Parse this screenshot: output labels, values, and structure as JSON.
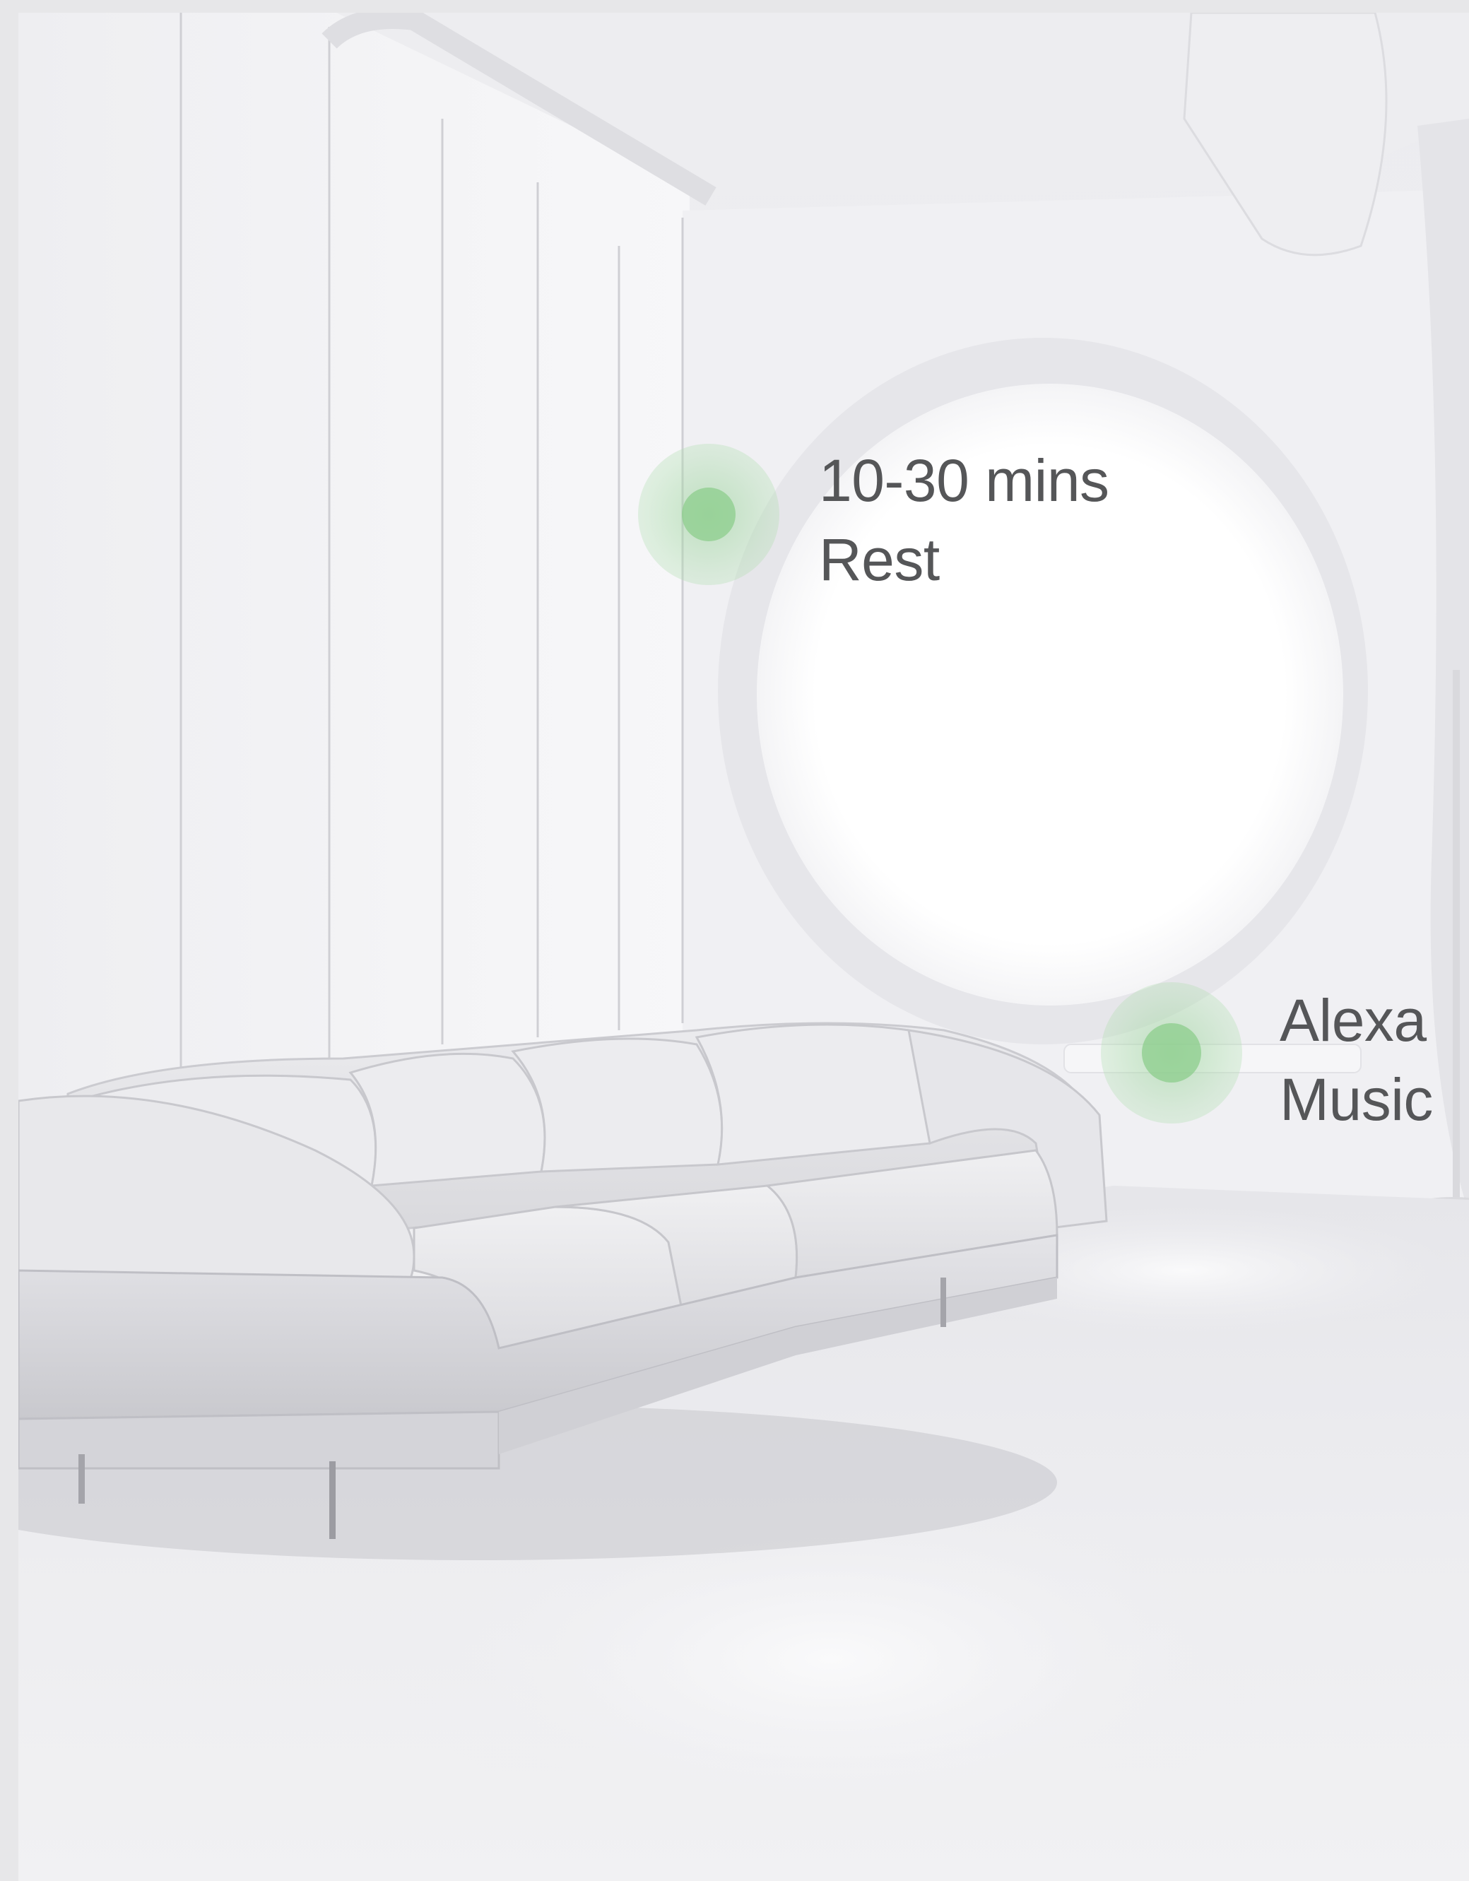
{
  "scene": {
    "description_icon": "living-room-image"
  },
  "hotspots": [
    {
      "label_line1": "10-30 mins",
      "label_line2": "Rest",
      "accent": "#8fd08f"
    },
    {
      "label_line1": "Alexa",
      "label_line2": "Music",
      "accent": "#8fd08f"
    }
  ],
  "colors": {
    "background": "#e7e7e9",
    "wall": "#f1f1f4",
    "window": "#ffffff",
    "label_text": "#555658",
    "hotspot_green": "#8fd08f"
  }
}
